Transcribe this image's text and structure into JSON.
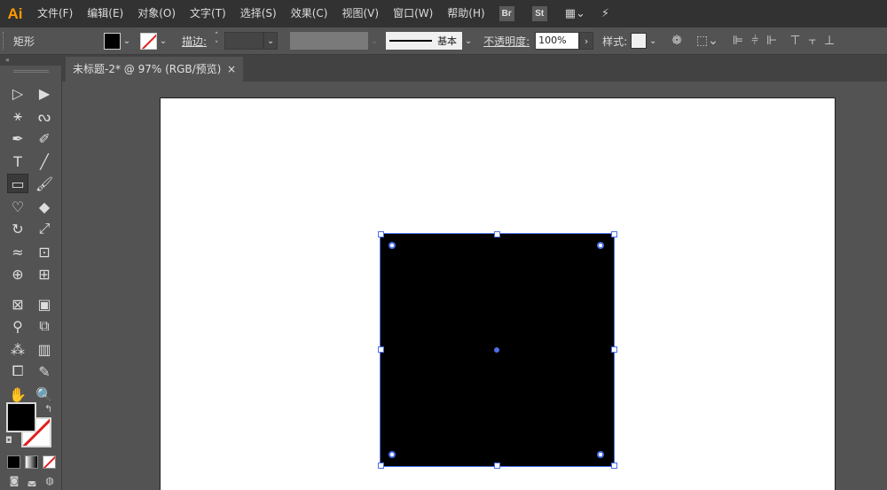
{
  "app": {
    "logo": "Ai"
  },
  "menu": {
    "items": [
      "文件(F)",
      "编辑(E)",
      "对象(O)",
      "文字(T)",
      "选择(S)",
      "效果(C)",
      "视图(V)",
      "窗口(W)",
      "帮助(H)"
    ],
    "bridge_badge": "Br",
    "stock_badge": "St"
  },
  "control": {
    "tool_name": "矩形",
    "stroke_label": "描边",
    "brush_name": "基本",
    "opacity_label": "不透明度",
    "opacity_value": "100%",
    "style_label": "样式",
    "colon": ":"
  },
  "document": {
    "tab_title": "未标题-2* @ 97% (RGB/预览)",
    "close": "×"
  },
  "colors": {
    "accent": "#4b6fe8",
    "logo": "#ff9a00",
    "stroke_none": "#e02020",
    "fill": "#000000"
  },
  "tools": [
    {
      "name": "selection-tool-icon",
      "glyph": "▷"
    },
    {
      "name": "direct-selection-tool-icon",
      "glyph": "▶"
    },
    {
      "name": "magic-wand-tool-icon",
      "glyph": "⚹"
    },
    {
      "name": "lasso-tool-icon",
      "glyph": "ᔓ"
    },
    {
      "name": "pen-tool-icon",
      "glyph": "✒"
    },
    {
      "name": "curvature-tool-icon",
      "glyph": "✐"
    },
    {
      "name": "type-tool-icon",
      "glyph": "T"
    },
    {
      "name": "line-segment-tool-icon",
      "glyph": "╱"
    },
    {
      "name": "rectangle-tool-icon",
      "glyph": "▭"
    },
    {
      "name": "paintbrush-tool-icon",
      "glyph": "🖌"
    },
    {
      "name": "shaper-tool-icon",
      "glyph": "♡"
    },
    {
      "name": "eraser-tool-icon",
      "glyph": "◆"
    },
    {
      "name": "rotate-tool-icon",
      "glyph": "↻"
    },
    {
      "name": "scale-tool-icon",
      "glyph": "⤢"
    },
    {
      "name": "width-tool-icon",
      "glyph": "≈"
    },
    {
      "name": "free-transform-tool-icon",
      "glyph": "⊡"
    },
    {
      "name": "shape-builder-tool-icon",
      "glyph": "⊕"
    },
    {
      "name": "perspective-grid-tool-icon",
      "glyph": "⊞"
    },
    {
      "name": "mesh-tool-icon",
      "glyph": "⊠"
    },
    {
      "name": "gradient-tool-icon",
      "glyph": "▣"
    },
    {
      "name": "eyedropper-tool-icon",
      "glyph": "⚲"
    },
    {
      "name": "blend-tool-icon",
      "glyph": "⧉"
    },
    {
      "name": "symbol-sprayer-tool-icon",
      "glyph": "⁂"
    },
    {
      "name": "column-graph-tool-icon",
      "glyph": "▥"
    },
    {
      "name": "artboard-tool-icon",
      "glyph": "⧠"
    },
    {
      "name": "slice-tool-icon",
      "glyph": "✎"
    },
    {
      "name": "hand-tool-icon",
      "glyph": "✋"
    },
    {
      "name": "zoom-tool-icon",
      "glyph": "🔍"
    }
  ]
}
